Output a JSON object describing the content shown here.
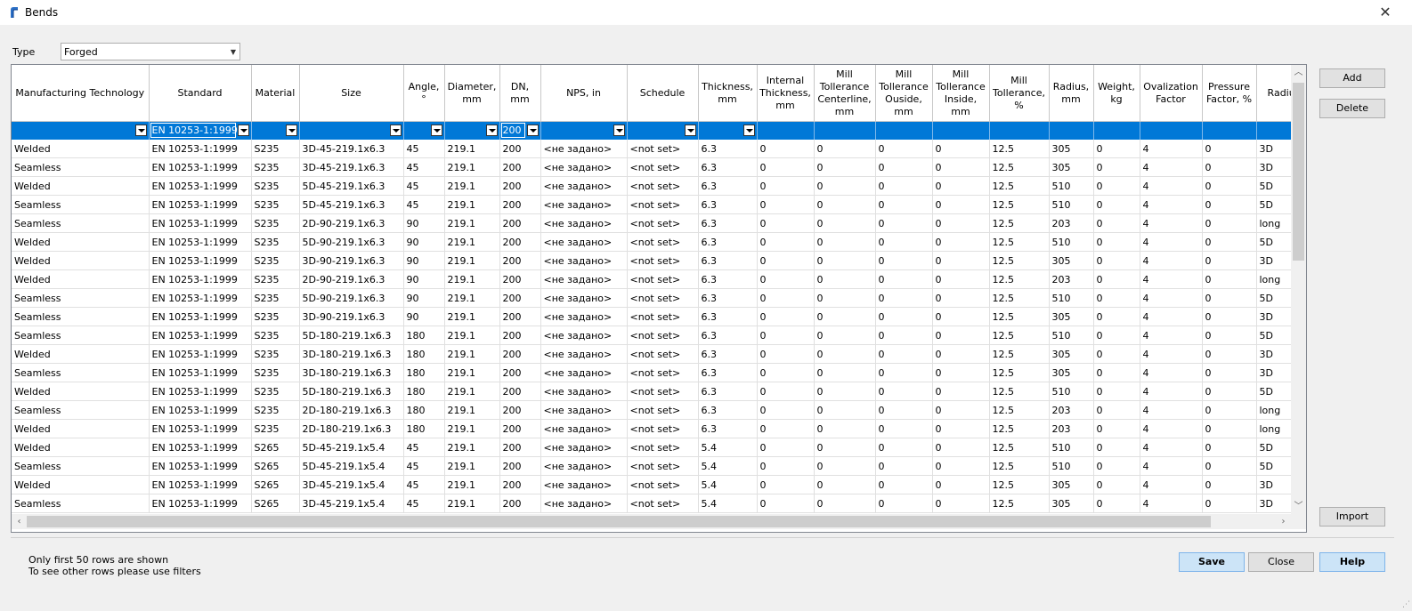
{
  "window": {
    "title": "Bends",
    "close_glyph": "✕"
  },
  "type_field": {
    "label": "Type",
    "value": "Forged"
  },
  "columns": [
    "Manufacturing Technology",
    "Standard",
    "Material",
    "Size",
    "Angle, °",
    "Diameter, mm",
    "DN, mm",
    "NPS, in",
    "Schedule",
    "Thickness, mm",
    "Internal Thickness, mm",
    "Mill Tollerance Centerline, mm",
    "Mill Tollerance Ouside, mm",
    "Mill Tollerance Inside, mm",
    "Mill Tollerance, %",
    "Radius, mm",
    "Weight, kg",
    "Ovalization Factor",
    "Pressure Factor, %",
    "Radius"
  ],
  "filters": {
    "standard": "EN 10253-1:1999",
    "dn": "200"
  },
  "rows": [
    [
      "Welded",
      "EN 10253-1:1999",
      "S235",
      "3D-45-219.1x6.3",
      "45",
      "219.1",
      "200",
      "<не задано>",
      "<not set>",
      "6.3",
      "0",
      "0",
      "0",
      "0",
      "12.5",
      "305",
      "0",
      "4",
      "0",
      "3D"
    ],
    [
      "Seamless",
      "EN 10253-1:1999",
      "S235",
      "3D-45-219.1x6.3",
      "45",
      "219.1",
      "200",
      "<не задано>",
      "<not set>",
      "6.3",
      "0",
      "0",
      "0",
      "0",
      "12.5",
      "305",
      "0",
      "4",
      "0",
      "3D"
    ],
    [
      "Welded",
      "EN 10253-1:1999",
      "S235",
      "5D-45-219.1x6.3",
      "45",
      "219.1",
      "200",
      "<не задано>",
      "<not set>",
      "6.3",
      "0",
      "0",
      "0",
      "0",
      "12.5",
      "510",
      "0",
      "4",
      "0",
      "5D"
    ],
    [
      "Seamless",
      "EN 10253-1:1999",
      "S235",
      "5D-45-219.1x6.3",
      "45",
      "219.1",
      "200",
      "<не задано>",
      "<not set>",
      "6.3",
      "0",
      "0",
      "0",
      "0",
      "12.5",
      "510",
      "0",
      "4",
      "0",
      "5D"
    ],
    [
      "Seamless",
      "EN 10253-1:1999",
      "S235",
      "2D-90-219.1x6.3",
      "90",
      "219.1",
      "200",
      "<не задано>",
      "<not set>",
      "6.3",
      "0",
      "0",
      "0",
      "0",
      "12.5",
      "203",
      "0",
      "4",
      "0",
      "long"
    ],
    [
      "Welded",
      "EN 10253-1:1999",
      "S235",
      "5D-90-219.1x6.3",
      "90",
      "219.1",
      "200",
      "<не задано>",
      "<not set>",
      "6.3",
      "0",
      "0",
      "0",
      "0",
      "12.5",
      "510",
      "0",
      "4",
      "0",
      "5D"
    ],
    [
      "Welded",
      "EN 10253-1:1999",
      "S235",
      "3D-90-219.1x6.3",
      "90",
      "219.1",
      "200",
      "<не задано>",
      "<not set>",
      "6.3",
      "0",
      "0",
      "0",
      "0",
      "12.5",
      "305",
      "0",
      "4",
      "0",
      "3D"
    ],
    [
      "Welded",
      "EN 10253-1:1999",
      "S235",
      "2D-90-219.1x6.3",
      "90",
      "219.1",
      "200",
      "<не задано>",
      "<not set>",
      "6.3",
      "0",
      "0",
      "0",
      "0",
      "12.5",
      "203",
      "0",
      "4",
      "0",
      "long"
    ],
    [
      "Seamless",
      "EN 10253-1:1999",
      "S235",
      "5D-90-219.1x6.3",
      "90",
      "219.1",
      "200",
      "<не задано>",
      "<not set>",
      "6.3",
      "0",
      "0",
      "0",
      "0",
      "12.5",
      "510",
      "0",
      "4",
      "0",
      "5D"
    ],
    [
      "Seamless",
      "EN 10253-1:1999",
      "S235",
      "3D-90-219.1x6.3",
      "90",
      "219.1",
      "200",
      "<не задано>",
      "<not set>",
      "6.3",
      "0",
      "0",
      "0",
      "0",
      "12.5",
      "305",
      "0",
      "4",
      "0",
      "3D"
    ],
    [
      "Seamless",
      "EN 10253-1:1999",
      "S235",
      "5D-180-219.1x6.3",
      "180",
      "219.1",
      "200",
      "<не задано>",
      "<not set>",
      "6.3",
      "0",
      "0",
      "0",
      "0",
      "12.5",
      "510",
      "0",
      "4",
      "0",
      "5D"
    ],
    [
      "Welded",
      "EN 10253-1:1999",
      "S235",
      "3D-180-219.1x6.3",
      "180",
      "219.1",
      "200",
      "<не задано>",
      "<not set>",
      "6.3",
      "0",
      "0",
      "0",
      "0",
      "12.5",
      "305",
      "0",
      "4",
      "0",
      "3D"
    ],
    [
      "Seamless",
      "EN 10253-1:1999",
      "S235",
      "3D-180-219.1x6.3",
      "180",
      "219.1",
      "200",
      "<не задано>",
      "<not set>",
      "6.3",
      "0",
      "0",
      "0",
      "0",
      "12.5",
      "305",
      "0",
      "4",
      "0",
      "3D"
    ],
    [
      "Welded",
      "EN 10253-1:1999",
      "S235",
      "5D-180-219.1x6.3",
      "180",
      "219.1",
      "200",
      "<не задано>",
      "<not set>",
      "6.3",
      "0",
      "0",
      "0",
      "0",
      "12.5",
      "510",
      "0",
      "4",
      "0",
      "5D"
    ],
    [
      "Seamless",
      "EN 10253-1:1999",
      "S235",
      "2D-180-219.1x6.3",
      "180",
      "219.1",
      "200",
      "<не задано>",
      "<not set>",
      "6.3",
      "0",
      "0",
      "0",
      "0",
      "12.5",
      "203",
      "0",
      "4",
      "0",
      "long"
    ],
    [
      "Welded",
      "EN 10253-1:1999",
      "S235",
      "2D-180-219.1x6.3",
      "180",
      "219.1",
      "200",
      "<не задано>",
      "<not set>",
      "6.3",
      "0",
      "0",
      "0",
      "0",
      "12.5",
      "203",
      "0",
      "4",
      "0",
      "long"
    ],
    [
      "Welded",
      "EN 10253-1:1999",
      "S265",
      "5D-45-219.1x5.4",
      "45",
      "219.1",
      "200",
      "<не задано>",
      "<not set>",
      "5.4",
      "0",
      "0",
      "0",
      "0",
      "12.5",
      "510",
      "0",
      "4",
      "0",
      "5D"
    ],
    [
      "Seamless",
      "EN 10253-1:1999",
      "S265",
      "5D-45-219.1x5.4",
      "45",
      "219.1",
      "200",
      "<не задано>",
      "<not set>",
      "5.4",
      "0",
      "0",
      "0",
      "0",
      "12.5",
      "510",
      "0",
      "4",
      "0",
      "5D"
    ],
    [
      "Welded",
      "EN 10253-1:1999",
      "S265",
      "3D-45-219.1x5.4",
      "45",
      "219.1",
      "200",
      "<не задано>",
      "<not set>",
      "5.4",
      "0",
      "0",
      "0",
      "0",
      "12.5",
      "305",
      "0",
      "4",
      "0",
      "3D"
    ],
    [
      "Seamless",
      "EN 10253-1:1999",
      "S265",
      "3D-45-219.1x5.4",
      "45",
      "219.1",
      "200",
      "<не задано>",
      "<not set>",
      "5.4",
      "0",
      "0",
      "0",
      "0",
      "12.5",
      "305",
      "0",
      "4",
      "0",
      "3D"
    ]
  ],
  "buttons": {
    "add": "Add",
    "delete": "Delete",
    "import": "Import",
    "save": "Save",
    "close": "Close",
    "help": "Help"
  },
  "footer": {
    "note_line1": "Only first 50 rows are shown",
    "note_line2": "To see other rows please use filters"
  },
  "colors": {
    "selection": "#0078d7",
    "primary_button": "#cce4f7"
  }
}
